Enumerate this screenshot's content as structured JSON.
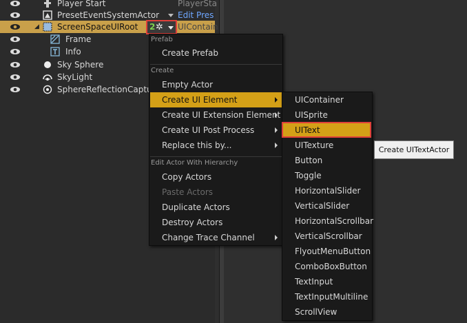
{
  "outliner": {
    "rows": [
      {
        "label": "Player Start",
        "col2": "PlayerSta",
        "icon": "player-start-icon"
      },
      {
        "label": "PresetEventSystemActor",
        "col2": "Edit Pres",
        "icon": "actor-icon"
      },
      {
        "label": "ScreenSpaceUIRoot",
        "col2": "UIContain",
        "icon": "ui-root-icon"
      },
      {
        "label": "Frame",
        "icon": "frame-icon"
      },
      {
        "label": "Info",
        "icon": "text-icon"
      },
      {
        "label": "Sky Sphere",
        "icon": "sphere-icon"
      },
      {
        "label": "SkyLight",
        "icon": "skylight-icon"
      },
      {
        "label": "SphereReflectionCapture",
        "icon": "reflection-capture-icon"
      }
    ],
    "ui_button": {
      "count": "2",
      "icon": "gear-icon"
    }
  },
  "context_menu": {
    "prefab_header": "Prefab",
    "create_prefab": "Create Prefab",
    "create_header": "Create",
    "empty_actor": "Empty Actor",
    "create_ui_element": "Create UI Element",
    "create_ui_extension": "Create UI Extension Element",
    "create_ui_post": "Create UI Post Process",
    "replace_by": "Replace this by...",
    "hierarchy_header": "Edit Actor With Hierarchy",
    "copy_actors": "Copy Actors",
    "paste_actors": "Paste Actors",
    "duplicate_actors": "Duplicate Actors",
    "destroy_actors": "Destroy Actors",
    "change_trace": "Change Trace Channel"
  },
  "submenu": {
    "items": [
      "UIContainer",
      "UISprite",
      "UIText",
      "UITexture",
      "Button",
      "Toggle",
      "HorizontalSlider",
      "VerticalSlider",
      "HorizontalScrollbar",
      "VerticalScrollbar",
      "FlyoutMenuButton",
      "ComboBoxButton",
      "TextInput",
      "TextInputMultiline",
      "ScrollView"
    ],
    "active": "UIText"
  },
  "tooltip": "Create UITextActor",
  "colors": {
    "selection": "#c9a04a",
    "menu_active": "#d4a017",
    "highlight_border": "#e0403a",
    "link": "#6ea6ff"
  }
}
